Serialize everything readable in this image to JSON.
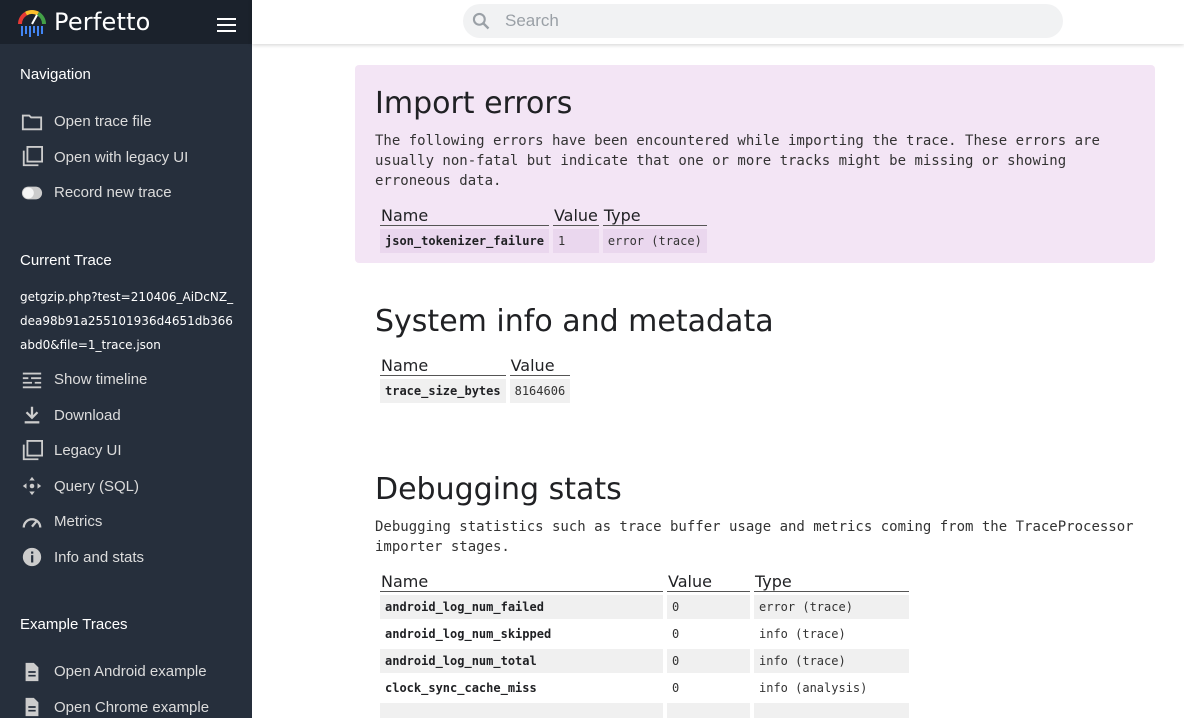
{
  "app": {
    "brand": "Perfetto"
  },
  "search": {
    "placeholder": "Search"
  },
  "sidebar": {
    "navigation": {
      "title": "Navigation",
      "items": [
        {
          "label": "Open trace file",
          "icon": "folder-icon"
        },
        {
          "label": "Open with legacy UI",
          "icon": "filter-none-icon"
        },
        {
          "label": "Record new trace",
          "icon": "record-toggle-icon"
        }
      ]
    },
    "current_trace": {
      "title": "Current Trace",
      "trace_name": "getgzip.php?test=210406_AiDcNZ_dea98b91a255101936d4651db366abd0&file=1_trace.json",
      "items": [
        {
          "label": "Show timeline",
          "icon": "timeline-icon"
        },
        {
          "label": "Download",
          "icon": "download-icon"
        },
        {
          "label": "Legacy UI",
          "icon": "filter-none-icon"
        },
        {
          "label": "Query (SQL)",
          "icon": "query-icon"
        },
        {
          "label": "Metrics",
          "icon": "speedometer-icon"
        },
        {
          "label": "Info and stats",
          "icon": "info-icon"
        }
      ]
    },
    "examples": {
      "title": "Example Traces",
      "items": [
        {
          "label": "Open Android example",
          "icon": "file-icon"
        },
        {
          "label": "Open Chrome example",
          "icon": "file-icon"
        }
      ]
    }
  },
  "import_errors": {
    "title": "Import errors",
    "description": "The following errors have been encountered while importing the trace. These errors are usually non-fatal but indicate that one or more tracks might be missing or showing erroneous data.",
    "headers": [
      "Name",
      "Value",
      "Type"
    ],
    "rows": [
      {
        "name": "json_tokenizer_failure",
        "value": "1",
        "type": "error (trace)"
      }
    ]
  },
  "system_info": {
    "title": "System info and metadata",
    "headers": [
      "Name",
      "Value"
    ],
    "rows": [
      {
        "name": "trace_size_bytes",
        "value": "8164606"
      }
    ]
  },
  "debug_stats": {
    "title": "Debugging stats",
    "description": "Debugging statistics such as trace buffer usage and metrics coming from the TraceProcessor importer stages.",
    "headers": [
      "Name",
      "Value",
      "Type"
    ],
    "rows": [
      {
        "name": "android_log_num_failed",
        "value": "0",
        "type": "error (trace)"
      },
      {
        "name": "android_log_num_skipped",
        "value": "0",
        "type": "info (trace)"
      },
      {
        "name": "android_log_num_total",
        "value": "0",
        "type": "info (trace)"
      },
      {
        "name": "clock_sync_cache_miss",
        "value": "0",
        "type": "info (analysis)"
      }
    ]
  }
}
